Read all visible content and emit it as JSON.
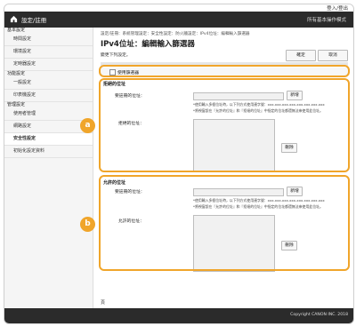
{
  "header": {
    "title": "設定/註冊",
    "mode_text": "所有基本操作模式",
    "user_link": "登入/登出"
  },
  "sidebar": {
    "sections": [
      {
        "label": "基本設定",
        "items": [
          {
            "label": "時間設定"
          },
          {
            "label": "環境設定"
          },
          {
            "label": "定時器設定"
          }
        ]
      },
      {
        "label": "功能設定",
        "items": [
          {
            "label": "一般設定"
          },
          {
            "label": "印表機設定"
          }
        ]
      },
      {
        "label": "管理設定",
        "items": [
          {
            "label": "使用者管理"
          },
          {
            "label": "網路設定"
          },
          {
            "label": "安全性設定"
          },
          {
            "label": "初始化設定資料"
          }
        ]
      }
    ]
  },
  "main": {
    "breadcrumb": "設定/註冊：系統管理設定：安全性設定：防火牆設定：IPv4位址：編輯輸入篩選器",
    "page_title": "IPv4位址：編輯輸入篩選器",
    "changed_label": "變更下列設定。",
    "ok_label": "確定",
    "cancel_label": "取消",
    "use_filter_label": "使用篩選器",
    "rejected": {
      "heading": "拒絕的位址",
      "address_label": "要註冊的位址：",
      "add_label": "新增",
      "list_label": "拒絕的位址：",
      "delete_label": "刪除",
      "note1": "*使用輸入多個位址時，以下列方式使用連字號：xxx.xxx.xxx.xxx-xxx.xxx.xxx.xxx",
      "note2": "*將視窗設在『允許的位址』和『拒絕的位址』中指定的位址都還無法來使用此位址。"
    },
    "allowed": {
      "heading": "允許的位址",
      "address_label": "要註冊的位址：",
      "add_label": "新增",
      "list_label": "允許的位址：",
      "delete_label": "刪除",
      "note1": "*使用輸入多個位址時，以下列方式使用連字號：xxx.xxx.xxx.xxx-xxx.xxx.xxx.xxx",
      "note2": "*將視窗設在『允許的位址』和『拒絕的位址』中指定的位址都還無法來使用此位址。"
    },
    "page_end": "頁"
  },
  "markers": {
    "a": "a",
    "b": "b"
  },
  "footer": {
    "copyright": "Copyright CANON INC. 2018"
  },
  "colors": {
    "header_bg": "#2b2b2b",
    "highlight": "#f0a52a",
    "sidebar_active": "#ffffff"
  }
}
